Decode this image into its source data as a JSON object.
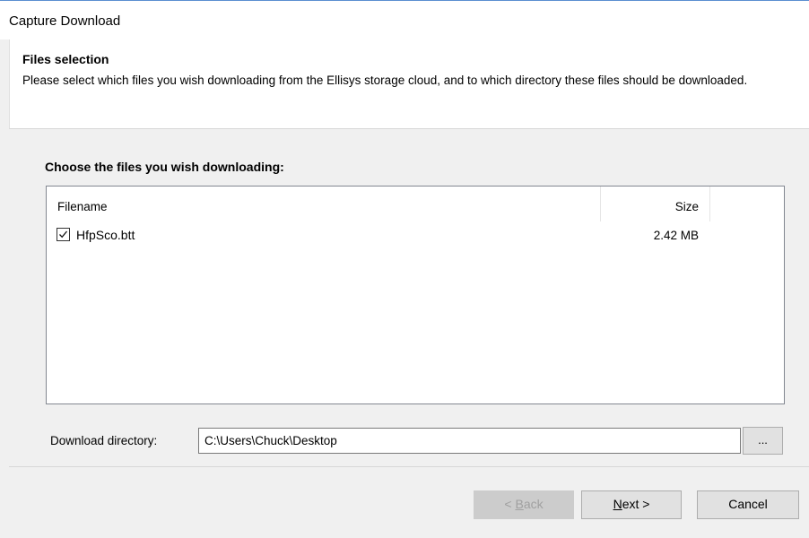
{
  "window": {
    "title": "Capture Download"
  },
  "header": {
    "title": "Files selection",
    "description": "Please select which files you wish downloading from the Ellisys storage cloud, and to which directory these files should be downloaded."
  },
  "files": {
    "label": "Choose the files you wish downloading:",
    "columns": {
      "filename": "Filename",
      "size": "Size"
    },
    "rows": [
      {
        "checked": true,
        "name": "HfpSco.btt",
        "size": "2.42 MB"
      }
    ]
  },
  "directory": {
    "label": "Download directory:",
    "value": "C:\\Users\\Chuck\\Desktop",
    "browse_label": "..."
  },
  "buttons": {
    "back": {
      "mnemonic": "B",
      "rest": "ack",
      "prefix": "< ",
      "enabled": false
    },
    "next": {
      "mnemonic": "N",
      "rest": "ext >"
    },
    "cancel": "Cancel"
  }
}
